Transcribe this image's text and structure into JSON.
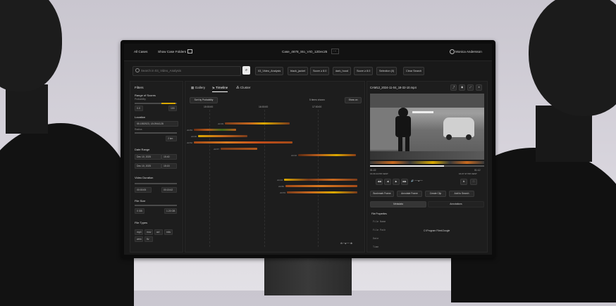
{
  "app": {
    "all_cases": "All Cases",
    "show_case_folders": "Show Case Folders",
    "case_title": "Case_4678_Sto_VIO_12Dec25",
    "user_name": "Monica Andersson"
  },
  "search": {
    "placeholder": "Search in 03_Video_Analysis",
    "chips": [
      "03_Video_Analysis",
      "black_jacket",
      "Score ≥ 8.0",
      "dark_hood",
      "Score ≥ 8.0",
      "Selection (0)",
      "Clear Search"
    ]
  },
  "filters": {
    "title": "Filters",
    "range_label": "Range of Scores",
    "range_sub": "Probability",
    "range_min": "0.0",
    "range_max": "100",
    "location_label": "Location",
    "location_value": "55.1552923, 18.0944128",
    "radius_label": "Radius",
    "radius_value": "2 km",
    "date_label": "Date Range",
    "from_date": "Dec 10, 2025",
    "from_time": "15:40",
    "to_date": "Dec 10, 2025",
    "to_time": "15:15",
    "duration_label": "Video Duration",
    "duration_from": "00:00:05",
    "duration_to": "00:15:42",
    "size_label": "File Size",
    "size_min": "0 GB",
    "size_max": "1.20 GB",
    "types_label": "File Types",
    "types": [
      "mp4",
      "mov",
      "avi",
      "mkv",
      "wmv",
      "flv"
    ]
  },
  "timeline": {
    "tabs": [
      "Gallery",
      "Timeline",
      "Cluster"
    ],
    "sort": "Sort by Probability",
    "items_shown": "5 items shown",
    "zoom_btn": "Show on",
    "ticks": [
      "15:00:00",
      "16:00:00",
      "17:00:00"
    ],
    "tracks": [
      {
        "label": "vid 39"
      },
      {
        "label": "vid 84"
      },
      {
        "label": "vid 40"
      },
      {
        "label": "vid 52"
      },
      {
        "label": "vid 67"
      },
      {
        "label": "vid 42"
      },
      {
        "label": "vid 44"
      },
      {
        "label": "vid 82"
      },
      {
        "label": "vid 63"
      }
    ]
  },
  "viewer": {
    "filename": "CAM12_2024-11-04_18-32-10.mp4",
    "time_start": "01:22",
    "time_end": "01:12",
    "date_left": "16.09.44 PM CEST",
    "date_right": "16.07.37 PM CEST",
    "actions": [
      "Bookmark Frame",
      "Annotate Frame",
      "Create Clip",
      "Add to Search"
    ],
    "tabs": [
      "Metadata",
      "Annotations"
    ],
    "props_title": "File Properties",
    "props": [
      {
        "key": "File Name",
        "value": ""
      },
      {
        "key": "File Path",
        "value": "C:\\Program Files\\Google"
      },
      {
        "key": "Date",
        "value": ""
      },
      {
        "key": "Time",
        "value": ""
      }
    ]
  }
}
